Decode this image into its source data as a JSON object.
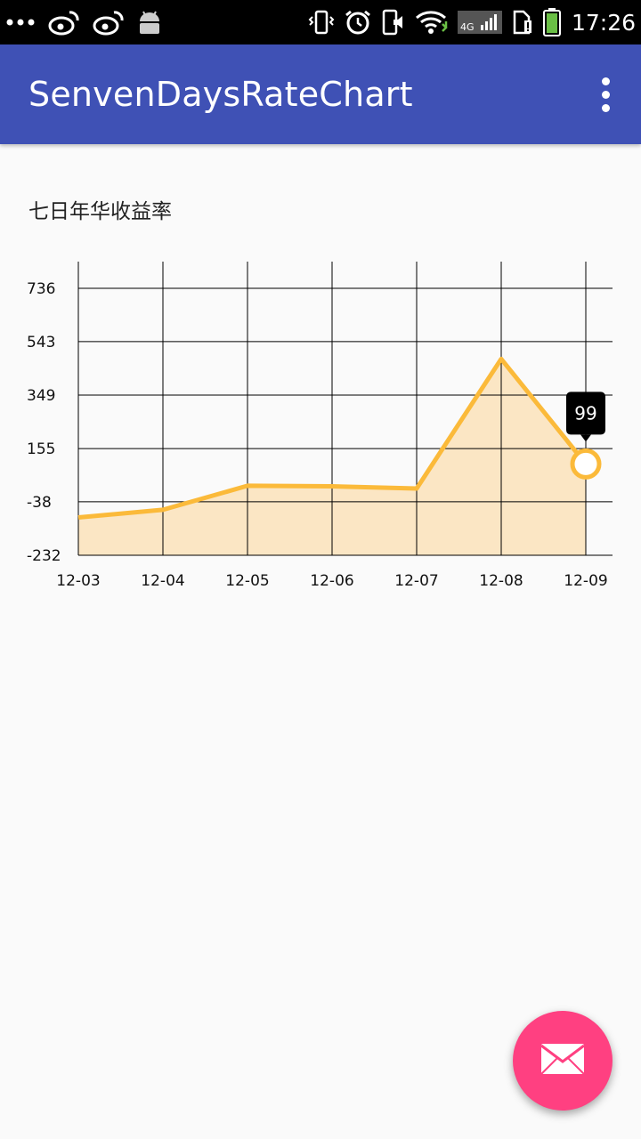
{
  "status_bar": {
    "time": "17:26",
    "network": "4G",
    "icons": [
      "more-dots-icon",
      "weibo-icon",
      "weibo-icon",
      "android-icon",
      "vibrate-icon",
      "alarm-icon",
      "sound-icon",
      "wifi-icon",
      "signal-icon",
      "sim-icon",
      "battery-icon"
    ]
  },
  "app_bar": {
    "title": "SenvenDaysRateChart",
    "overflow_icon": "more-vert-icon"
  },
  "chart_section": {
    "title": "七日年华收益率"
  },
  "chart_data": {
    "type": "area",
    "categories": [
      "12-03",
      "12-04",
      "12-05",
      "12-06",
      "12-07",
      "12-08",
      "12-09"
    ],
    "values": [
      -95,
      -67,
      20,
      18,
      10,
      480,
      99
    ],
    "y_ticks": [
      "736",
      "543",
      "349",
      "155",
      "-38",
      "-232"
    ],
    "ylim": [
      -232,
      833
    ],
    "grid": true,
    "highlight": {
      "index": 6,
      "label": "99"
    },
    "colors": {
      "line": "#FBBA3A",
      "fill": "#FBE6C4",
      "grid": "#000000",
      "tooltip_bg": "#000000",
      "tooltip_text": "#FFFFFF"
    }
  },
  "fab": {
    "icon": "mail-icon",
    "color": "#FF4081"
  },
  "colors": {
    "primary": "#3F51B5",
    "background": "#FAFAFA",
    "accent": "#FF4081"
  }
}
